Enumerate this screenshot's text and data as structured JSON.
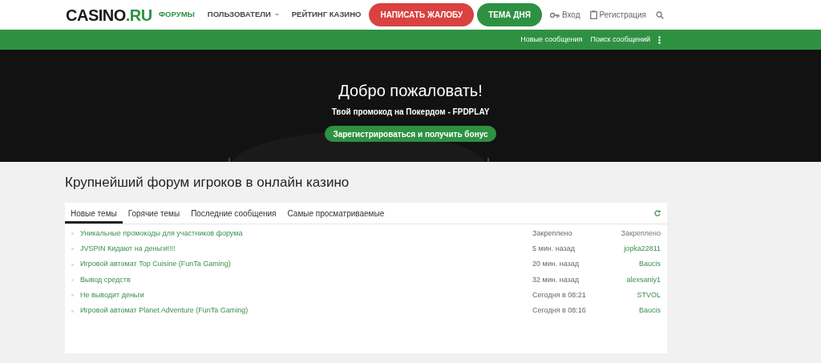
{
  "header": {
    "logo": {
      "main": "CASINO",
      "accent": ".RU"
    },
    "nav": [
      {
        "label": "ФОРУМЫ",
        "selected": true,
        "has_menu": false
      },
      {
        "label": "ПОЛЬЗОВАТЕЛИ",
        "selected": false,
        "has_menu": true
      },
      {
        "label": "РЕЙТИНГ КАЗИНО",
        "selected": false,
        "has_menu": false
      }
    ],
    "buttons": [
      {
        "label": "НАПИСАТЬ ЖАЛОБУ",
        "kind": "red"
      },
      {
        "label": "ТЕМА ДНЯ",
        "kind": "green"
      }
    ],
    "login": "Вход",
    "register": "Регистрация"
  },
  "subnav": [
    "Новые сообщения",
    "Поиск сообщений"
  ],
  "hero": {
    "title": "Добро пожаловать!",
    "subtitle": "Твой промокод на Покердом - FPDPLAY",
    "button": "Зарегистрироваться и получить бонус"
  },
  "page_title": "Крупнейший форум игроков в онлайн казино",
  "tabs": [
    {
      "label": "Новые темы",
      "selected": true
    },
    {
      "label": "Горячие темы",
      "selected": false
    },
    {
      "label": "Последние сообщения",
      "selected": false
    },
    {
      "label": "Самые просматриваемые",
      "selected": false
    }
  ],
  "threads": [
    {
      "title": "Уникальные промокоды для участников форума",
      "time": "Закреплено",
      "author": "Закреплено",
      "pinned": true
    },
    {
      "title": "JVSPIN Кидают на деньги!!!!",
      "time": "5 мин. назад",
      "author": "jopka22811",
      "pinned": false
    },
    {
      "title": "Игровой автомат Top Cuisine (FunTa Gaming)",
      "time": "20 мин. назад",
      "author": "Baucis",
      "pinned": false
    },
    {
      "title": "Вывод средств",
      "time": "32 мин. назад",
      "author": "alexsaniy1",
      "pinned": false
    },
    {
      "title": "Не выводит деньги",
      "time": "Сегодня в 08:21",
      "author": "STVOL",
      "pinned": false
    },
    {
      "title": "Игровой автомат Planet Adventure (FunTa Gaming)",
      "time": "Сегодня в 08:16",
      "author": "Baucis",
      "pinned": false
    }
  ]
}
